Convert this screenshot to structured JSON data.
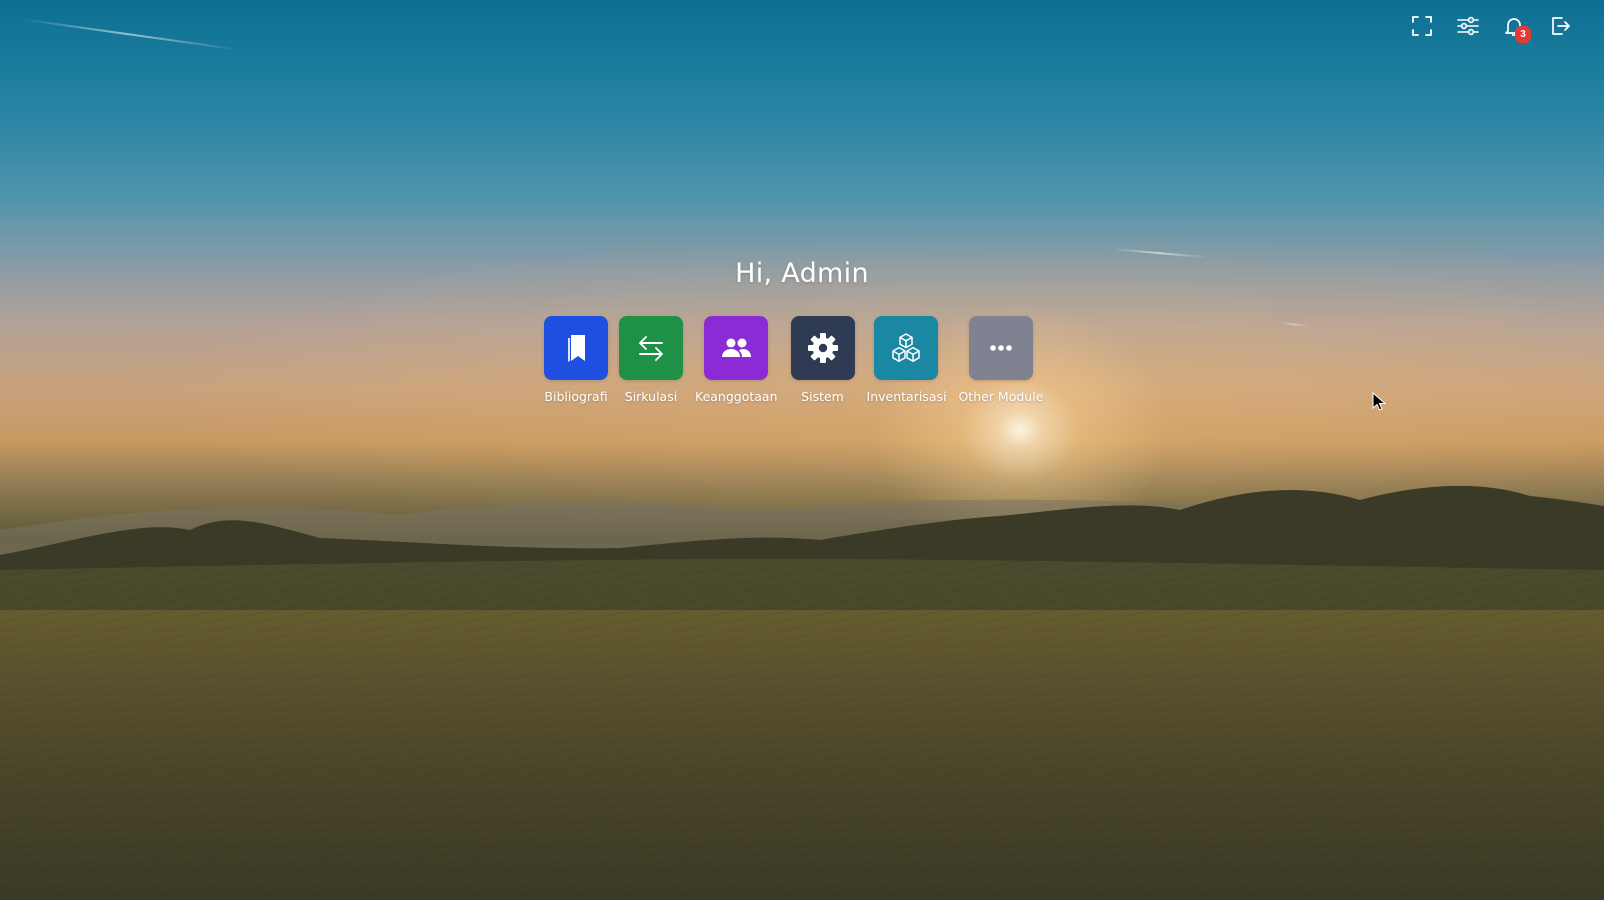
{
  "toolbar": {
    "fullscreen_icon": "fullscreen-icon",
    "settings_icon": "sliders-icon",
    "notifications_icon": "bell-icon",
    "notifications_count": "3",
    "logout_icon": "logout-icon"
  },
  "greeting": "Hi, Admin",
  "modules": [
    {
      "label": "Bibliografi",
      "icon": "bookmark-icon",
      "color": "#1f4fe0"
    },
    {
      "label": "Sirkulasi",
      "icon": "arrows-exchange-icon",
      "color": "#1e9146"
    },
    {
      "label": "Keanggotaan",
      "icon": "users-icon",
      "color": "#8b2bd6"
    },
    {
      "label": "Sistem",
      "icon": "gear-icon",
      "color": "#2f3b52"
    },
    {
      "label": "Inventarisasi",
      "icon": "cubes-icon",
      "color": "#1a87a3"
    },
    {
      "label": "Other Module",
      "icon": "ellipsis-icon",
      "color": "#7f8290"
    }
  ],
  "colors": {
    "badge": "#e53935"
  }
}
